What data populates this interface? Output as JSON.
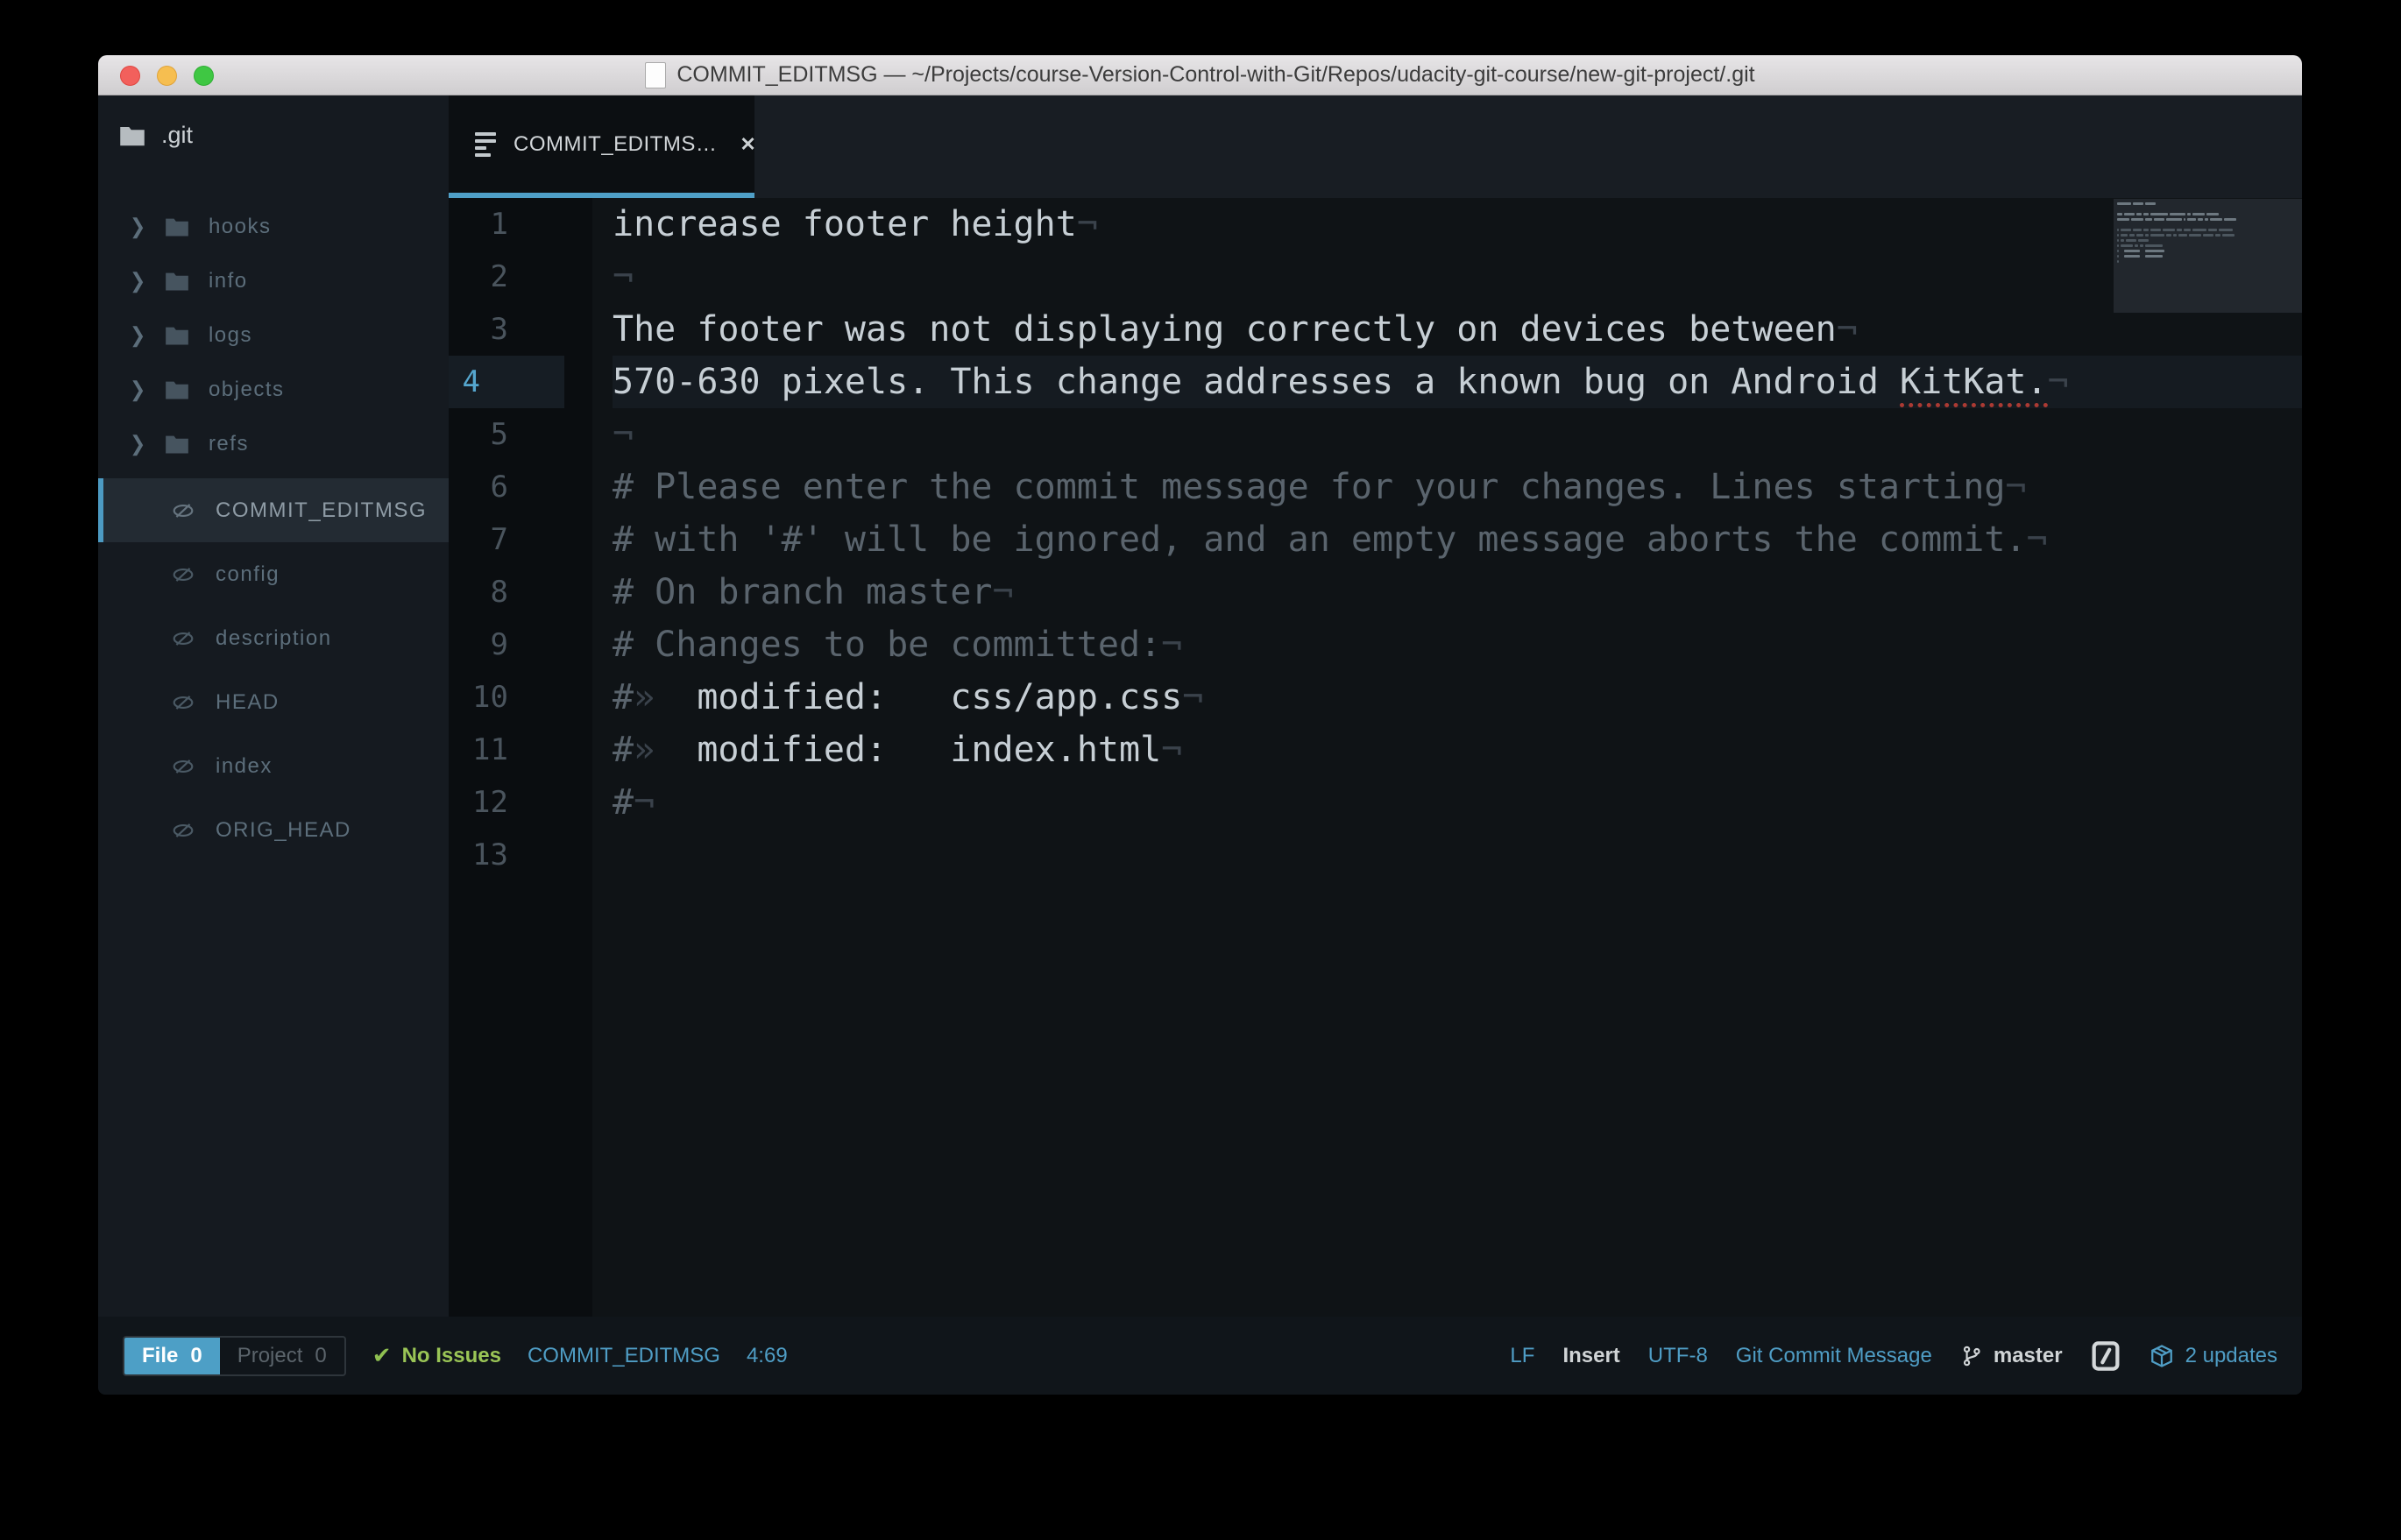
{
  "colors": {
    "accent_blue": "#4f9fc7",
    "selection_blue": "#4c9ac2",
    "status_green": "#9ac556",
    "misspell_red": "#ab3a33",
    "traffic_red": "#f2605c",
    "traffic_yellow": "#f6be50",
    "traffic_green": "#3fc743"
  },
  "window": {
    "title": "COMMIT_EDITMSG — ~/Projects/course-Version-Control-with-Git/Repos/udacity-git-course/new-git-project/.git"
  },
  "sidebar": {
    "root_label": ".git",
    "folders": [
      "hooks",
      "info",
      "logs",
      "objects",
      "refs"
    ],
    "files": [
      {
        "name": "COMMIT_EDITMSG",
        "selected": true
      },
      {
        "name": "config",
        "selected": false
      },
      {
        "name": "description",
        "selected": false
      },
      {
        "name": "HEAD",
        "selected": false
      },
      {
        "name": "index",
        "selected": false
      },
      {
        "name": "ORIG_HEAD",
        "selected": false
      }
    ]
  },
  "tabbar": {
    "active_tab_label": "COMMIT_EDITMS…",
    "close_glyph": "✕"
  },
  "editor": {
    "eol_glyph": "¬",
    "tab_glyph": "»",
    "cursor_line": 4,
    "lines": [
      {
        "num": 1,
        "segments": [
          [
            "increase footer height",
            "t"
          ],
          [
            "¬",
            "i"
          ]
        ]
      },
      {
        "num": 2,
        "segments": [
          [
            "¬",
            "i"
          ]
        ]
      },
      {
        "num": 3,
        "segments": [
          [
            "The footer was not displaying correctly on devices between",
            "t"
          ],
          [
            "¬",
            "i"
          ]
        ]
      },
      {
        "num": 4,
        "segments": [
          [
            "570-630 pixels. This change addresses a known bug on Android ",
            "t"
          ],
          [
            "KitKat.",
            "m"
          ],
          [
            "¬",
            "i"
          ]
        ]
      },
      {
        "num": 5,
        "segments": [
          [
            "¬",
            "i"
          ]
        ]
      },
      {
        "num": 6,
        "segments": [
          [
            "# Please enter the commit message for your changes. Lines starting",
            "c"
          ],
          [
            "¬",
            "i"
          ]
        ]
      },
      {
        "num": 7,
        "segments": [
          [
            "# with '#' will be ignored, and an empty message aborts the commit.",
            "c"
          ],
          [
            "¬",
            "i"
          ]
        ]
      },
      {
        "num": 8,
        "segments": [
          [
            "# On branch master",
            "c"
          ],
          [
            "¬",
            "i"
          ]
        ]
      },
      {
        "num": 9,
        "segments": [
          [
            "# Changes to be committed:",
            "c"
          ],
          [
            "¬",
            "i"
          ]
        ]
      },
      {
        "num": 10,
        "segments": [
          [
            "#",
            "c"
          ],
          [
            "»",
            "i"
          ],
          [
            "  modified:   css/app.css",
            "t"
          ],
          [
            "¬",
            "i"
          ]
        ]
      },
      {
        "num": 11,
        "segments": [
          [
            "#",
            "c"
          ],
          [
            "»",
            "i"
          ],
          [
            "  modified:   index.html",
            "t"
          ],
          [
            "¬",
            "i"
          ]
        ]
      },
      {
        "num": 12,
        "segments": [
          [
            "#",
            "c"
          ],
          [
            "¬",
            "i"
          ]
        ]
      },
      {
        "num": 13,
        "segments": []
      }
    ]
  },
  "statusbar": {
    "left": {
      "file_label": "File",
      "file_count": "0",
      "project_label": "Project",
      "project_count": "0",
      "check_glyph": "✔",
      "issues": "No Issues",
      "filename": "COMMIT_EDITMSG",
      "cursor_position": "4:69"
    },
    "right": {
      "line_ending": "LF",
      "mode": "Insert",
      "encoding": "UTF-8",
      "grammar": "Git Commit Message",
      "branch": "master",
      "updates": "2 updates"
    }
  }
}
